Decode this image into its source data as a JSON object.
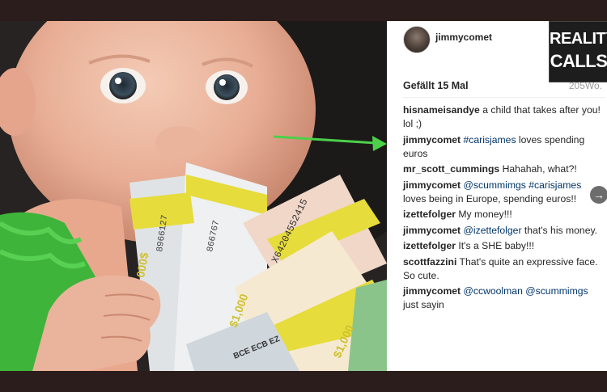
{
  "post": {
    "username": "jimmycomet",
    "likes": "Gefällt 15 Mal",
    "age": "205Wo."
  },
  "comments": [
    {
      "user": "hisnameisandye",
      "parts": [
        {
          "t": "a child that takes after you! lol ;)",
          "tag": false
        }
      ]
    },
    {
      "user": "jimmycomet",
      "parts": [
        {
          "t": "#carisjames",
          "tag": true
        },
        {
          "t": " loves spending euros",
          "tag": false
        }
      ]
    },
    {
      "user": "mr_scott_cummings",
      "parts": [
        {
          "t": "Hahahah, what?!",
          "tag": false
        }
      ]
    },
    {
      "user": "jimmycomet",
      "parts": [
        {
          "t": "@scummimgs",
          "tag": true
        },
        {
          "t": " ",
          "tag": false
        },
        {
          "t": "#carisjames",
          "tag": true
        },
        {
          "t": " loves being in Europe, spending euros!!",
          "tag": false
        }
      ]
    },
    {
      "user": "izettefolger",
      "parts": [
        {
          "t": "My money!!!",
          "tag": false
        }
      ]
    },
    {
      "user": "jimmycomet",
      "parts": [
        {
          "t": "@izettefolger",
          "tag": true
        },
        {
          "t": " that's his money.",
          "tag": false
        }
      ]
    },
    {
      "user": "izettefolger",
      "parts": [
        {
          "t": "It's a SHE baby!!!",
          "tag": false
        }
      ]
    },
    {
      "user": "scottfazzini",
      "parts": [
        {
          "t": "That's quite an expressive face. So cute.",
          "tag": false
        }
      ]
    },
    {
      "user": "jimmycomet",
      "parts": [
        {
          "t": "@ccwoolman",
          "tag": true
        },
        {
          "t": " ",
          "tag": false
        },
        {
          "t": "@scummimgs",
          "tag": true
        },
        {
          "t": " just sayin",
          "tag": false
        }
      ]
    }
  ],
  "logo": {
    "line1": "REALITY",
    "line2": "CALLS"
  },
  "photo_text": {
    "serial_1": "8966127",
    "serial_2": "866767",
    "serial_3": "X64204552415",
    "ecb": "BCE ECB EZ",
    "band_1": "000$",
    "band_2": "$1,000",
    "band_3": "$1,000"
  },
  "icons": {
    "next": "arrow-right-icon",
    "pointer": "green-arrow"
  },
  "colors": {
    "hashtag": "#003569",
    "green_arrow": "#4cd04a"
  }
}
